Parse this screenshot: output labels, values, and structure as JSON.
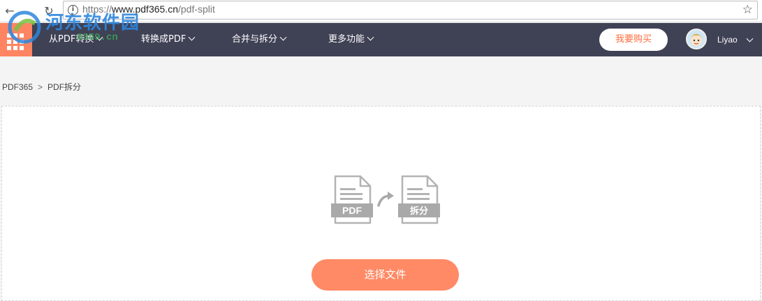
{
  "browser": {
    "url_scheme": "https://",
    "url_host": "www.pdf365.cn",
    "url_path": "/pdf-split"
  },
  "header": {
    "menu": [
      {
        "label": "从PDF转换"
      },
      {
        "label": "转换成PDF"
      },
      {
        "label": "合并与拆分"
      },
      {
        "label": "更多功能"
      }
    ],
    "buy_label": "我要购买",
    "username": "Liyao"
  },
  "watermark": {
    "name": "河东软件园",
    "url": "0359.cn"
  },
  "breadcrumb": {
    "home": "PDF365",
    "separator": ">",
    "current": "PDF拆分"
  },
  "illustration": {
    "source_label": "PDF",
    "target_label": "拆分"
  },
  "upload": {
    "button_label": "选择文件"
  },
  "colors": {
    "header_bg": "#3f4155",
    "accent": "#ff8a65",
    "logo_bg": "#ff8562"
  }
}
